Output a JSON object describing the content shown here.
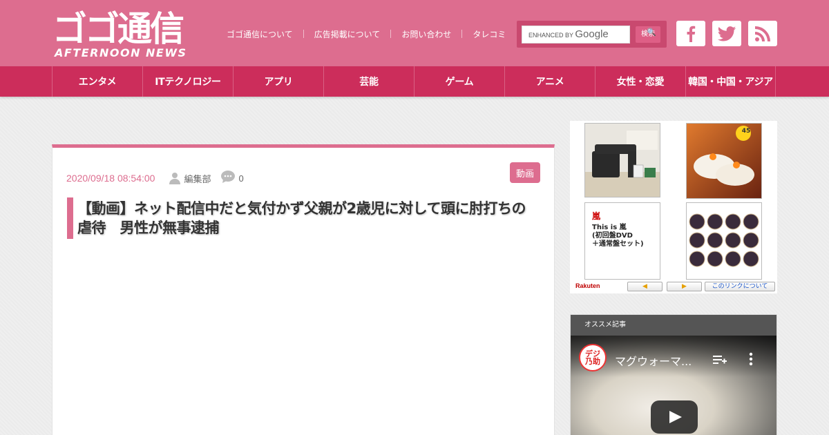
{
  "header": {
    "logo_main": "ゴゴ通信",
    "logo_sub": "AFTERNOON NEWS",
    "links": [
      "ゴゴ通信について",
      "広告掲載について",
      "お問い合わせ",
      "タレコミ"
    ],
    "search": {
      "enhanced_by": "ENHANCED BY",
      "google": "Google",
      "button_label": "検索"
    },
    "social": [
      "facebook-icon",
      "twitter-icon",
      "rss-icon"
    ],
    "bg_color": "#dd6d8f"
  },
  "nav": {
    "items": [
      "エンタメ",
      "ITテクノロジー",
      "アプリ",
      "芸能",
      "ゲーム",
      "アニメ",
      "女性・恋愛",
      "韓国・中国・アジア"
    ],
    "bg_color": "#cc2d5b"
  },
  "article": {
    "date": "2020/09/18 08:54:00",
    "author": "編集部",
    "comment_count": "0",
    "category": "動画",
    "title": "【動画】ネット配信中だと気付かず父親が2歳児に対して頭に肘打ちの虐待　男性が無事逮捕"
  },
  "ad": {
    "tile2_title": "嵐",
    "tile2_text": "This is 嵐\n(初回盤DVD\n＋通常盤セット)",
    "tile3_badge": "45",
    "brand": "Rakuten",
    "prev_label": "◀",
    "next_label": "▶",
    "about_label": "このリンクについて"
  },
  "recommend": {
    "heading": "オススメ記事",
    "video_title": "マグウォーマ...",
    "channel_label": "デジ\n乃助"
  }
}
